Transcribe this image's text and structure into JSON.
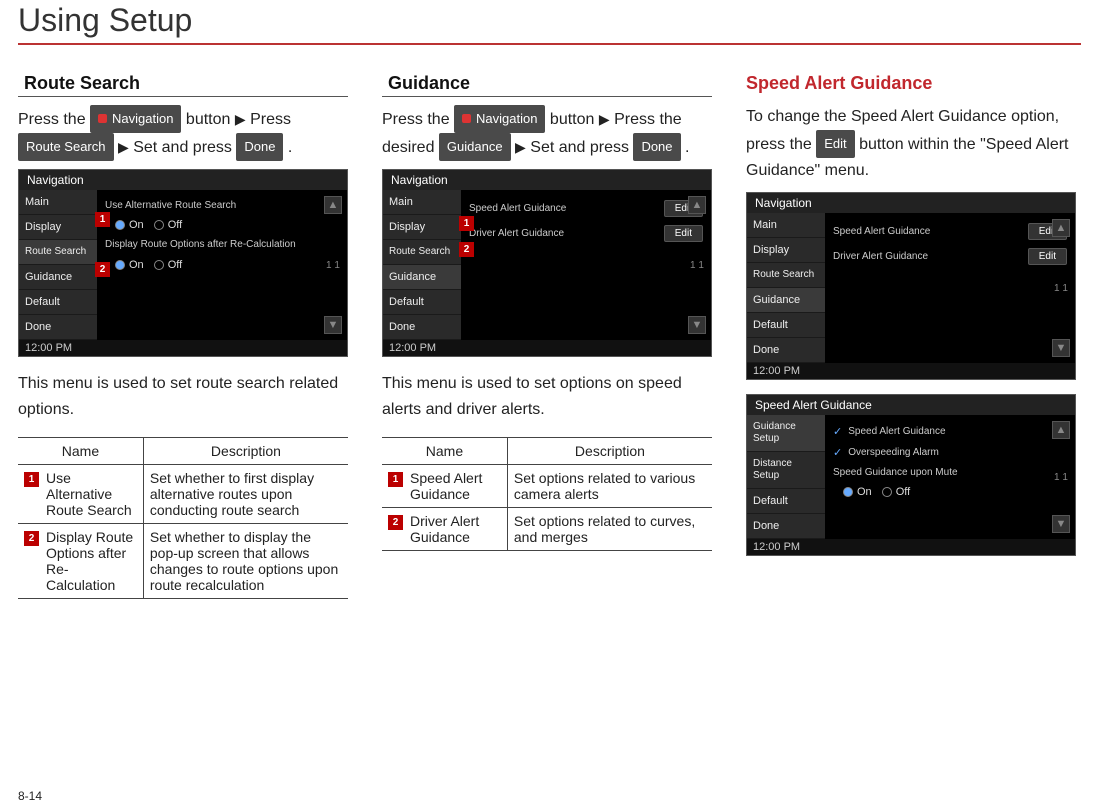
{
  "pageTitle": "Using Setup",
  "pageNumber": "8-14",
  "buttons": {
    "navigation": "Navigation",
    "routeSearch": "Route Search",
    "done": "Done",
    "guidance": "Guidance",
    "edit": "Edit"
  },
  "pointer": "▶",
  "col1": {
    "heading": "Route Search",
    "instr": {
      "a": "Press the ",
      "b": " button ",
      "c": " Press ",
      "d": " ",
      "e": " Set and press ",
      "f": " ."
    },
    "shot": {
      "title": "Navigation",
      "side": [
        "Main",
        "Display",
        "Route\nSearch",
        "Guidance",
        "Default",
        "Done"
      ],
      "main": {
        "row1": "Use Alternative Route Search",
        "row2": "Display Route Options after\nRe-Calculation",
        "on": "On",
        "off": "Off",
        "page": "1\n1"
      },
      "clock": "12:00 PM"
    },
    "desc": "This menu is used to set route search related options.",
    "table": {
      "h1": "Name",
      "h2": "Description",
      "rows": [
        {
          "num": "1",
          "name": "Use\nAlternative\nRoute Search",
          "desc": "Set whether to first display alternative routes upon conducting route search"
        },
        {
          "num": "2",
          "name": "Display Route Options after Re-Calculation",
          "desc": "Set whether to display the pop-up screen that allows changes to route options upon route recalculation"
        }
      ]
    }
  },
  "col2": {
    "heading": "Guidance",
    "instr": {
      "a": "Press the ",
      "b": " button ",
      "c": " Press the desired ",
      "d": " ",
      "e": " Set and press ",
      "f": " ."
    },
    "shot": {
      "title": "Navigation",
      "side": [
        "Main",
        "Display",
        "Route\nSearch",
        "Guidance",
        "Default",
        "Done"
      ],
      "main": {
        "row1": "Speed Alert Guidance",
        "row2": "Driver Alert Guidance",
        "edit": "Edit",
        "page": "1\n1"
      },
      "clock": "12:00 PM"
    },
    "desc": "This menu is used to set options on speed alerts and driver alerts.",
    "table": {
      "h1": "Name",
      "h2": "Description",
      "rows": [
        {
          "num": "1",
          "name": "Speed Alert Guidance",
          "desc": "Set options related to various camera alerts"
        },
        {
          "num": "2",
          "name": "Driver Alert Guidance",
          "desc": "Set options related to curves, and merges"
        }
      ]
    }
  },
  "col3": {
    "heading": "Speed Alert Guidance",
    "instr": {
      "a": "To change the Speed Alert Guidance option, press the ",
      "b": " button within the \"Speed Alert Guidance\" menu."
    },
    "shot1": {
      "title": "Navigation",
      "side": [
        "Main",
        "Display",
        "Route\nSearch",
        "Guidance",
        "Default",
        "Done"
      ],
      "main": {
        "row1": "Speed Alert Guidance",
        "row2": "Driver Alert Guidance",
        "edit": "Edit",
        "page": "1\n1"
      },
      "clock": "12:00 PM"
    },
    "shot2": {
      "title": "Speed Alert Guidance",
      "side": [
        "Guidance\nSetup",
        "Distance\nSetup",
        "Default",
        "Done"
      ],
      "main": {
        "row1": "Speed Alert Guidance",
        "row2": "Overspeeding Alarm",
        "row3": "Speed Guidance upon Mute",
        "on": "On",
        "off": "Off",
        "page": "1\n1"
      },
      "clock": "12:00 PM"
    }
  }
}
